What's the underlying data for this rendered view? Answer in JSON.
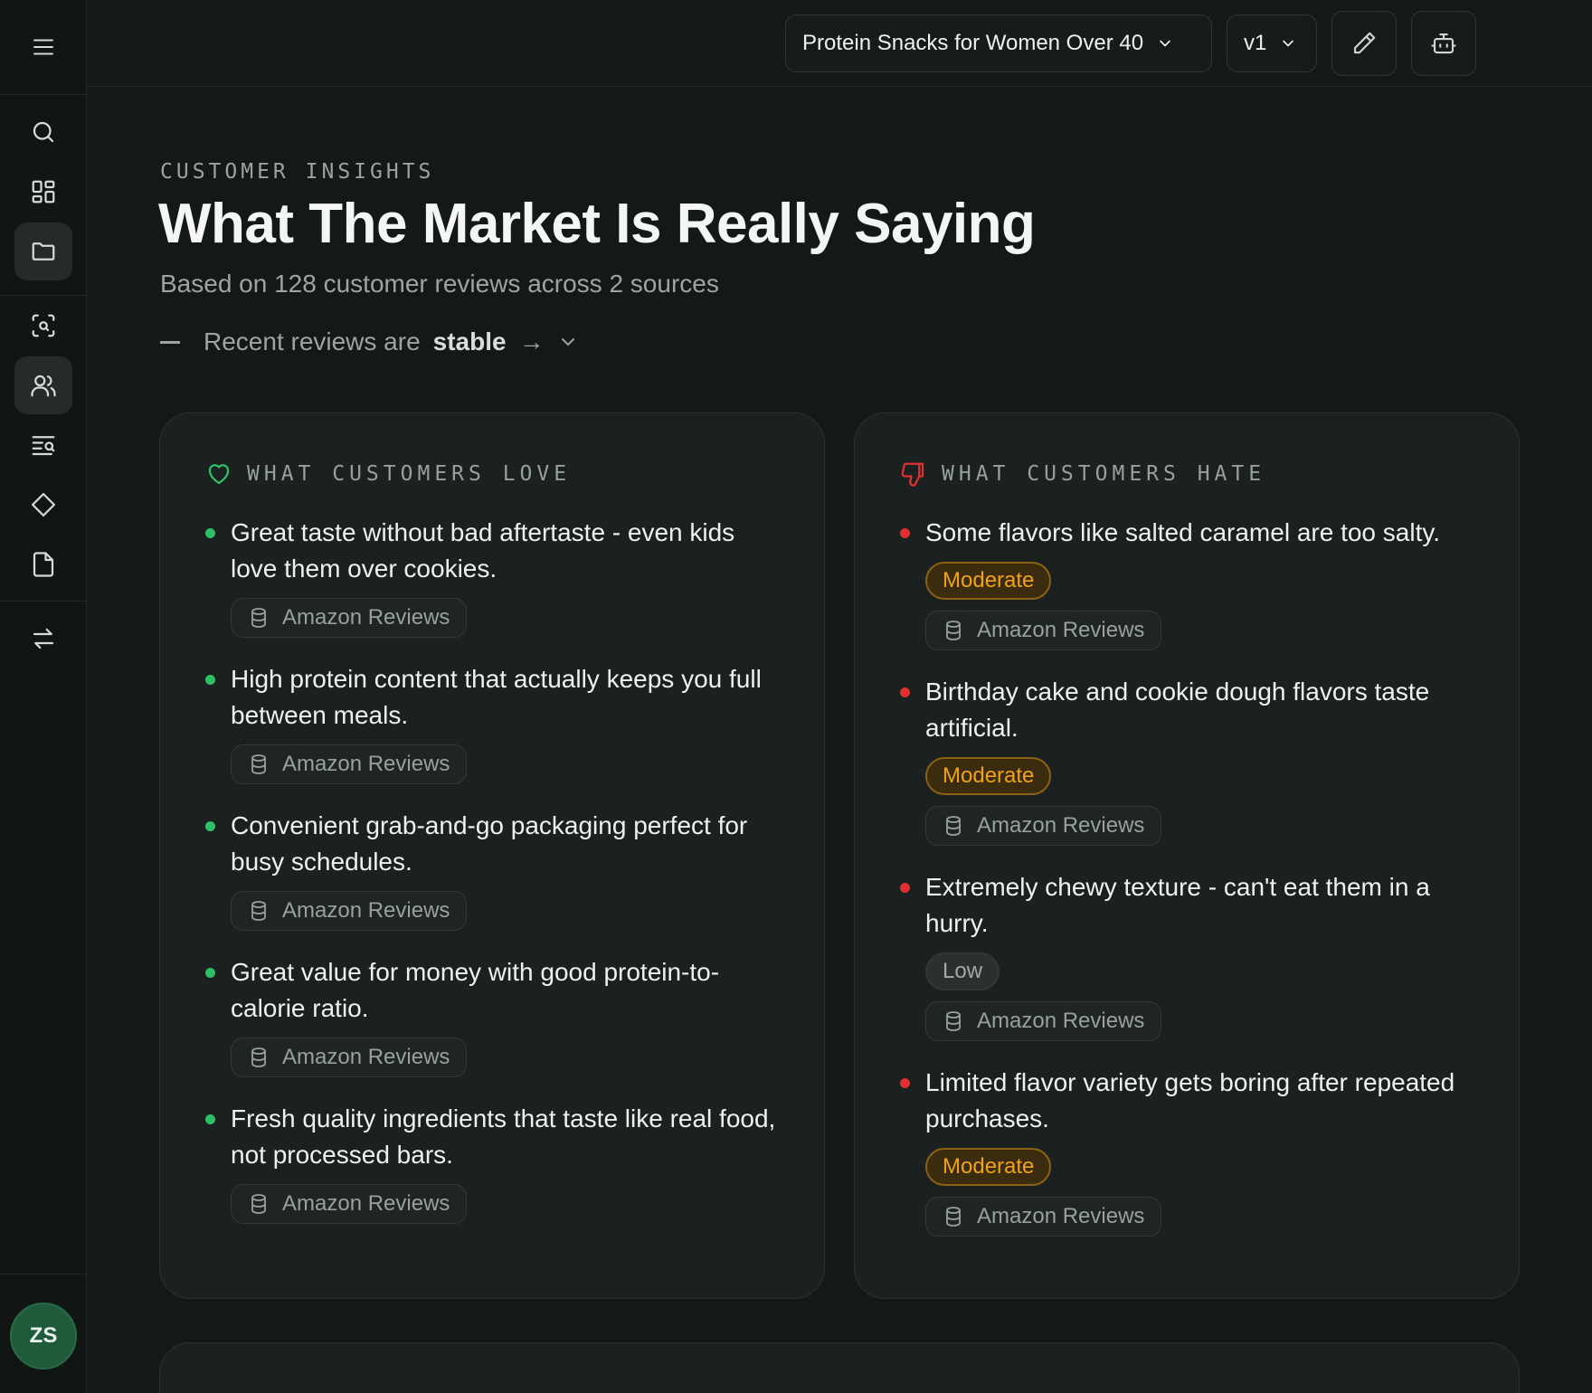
{
  "topbar": {
    "project_select": "Protein Snacks for Women Over 40",
    "version_select": "v1"
  },
  "sidebar": {
    "items": [
      {
        "name": "menu-icon"
      },
      {
        "name": "search-icon"
      },
      {
        "name": "dashboard-icon"
      },
      {
        "name": "folder-icon",
        "active": true
      },
      {
        "name": "scan-search-icon"
      },
      {
        "name": "users-icon",
        "active": true
      },
      {
        "name": "text-search-icon"
      },
      {
        "name": "diamond-icon"
      },
      {
        "name": "file-icon"
      },
      {
        "name": "swap-icon"
      }
    ],
    "avatar_initials": "ZS"
  },
  "header": {
    "eyebrow": "CUSTOMER INSIGHTS",
    "title": "What The Market Is Really Saying",
    "subtitle": "Based on 128 customer reviews across 2 sources",
    "trend_prefix": "Recent reviews are",
    "trend_value": "stable",
    "trend_arrow": "→"
  },
  "love": {
    "heading": "WHAT CUSTOMERS LOVE",
    "accent": "#2fbf64",
    "items": [
      {
        "text": "Great taste without bad aftertaste - even kids love them over cookies.",
        "source": "Amazon Reviews"
      },
      {
        "text": "High protein content that actually keeps you full between meals.",
        "source": "Amazon Reviews"
      },
      {
        "text": "Convenient grab-and-go packaging perfect for busy schedules.",
        "source": "Amazon Reviews"
      },
      {
        "text": "Great value for money with good protein-to-calorie ratio.",
        "source": "Amazon Reviews"
      },
      {
        "text": "Fresh quality ingredients that taste like real food, not processed bars.",
        "source": "Amazon Reviews"
      }
    ]
  },
  "hate": {
    "heading": "WHAT CUSTOMERS HATE",
    "accent": "#e03131",
    "items": [
      {
        "text": "Some flavors like salted caramel are too salty.",
        "severity": "Moderate",
        "source": "Amazon Reviews"
      },
      {
        "text": "Birthday cake and cookie dough flavors taste artificial.",
        "severity": "Moderate",
        "source": "Amazon Reviews"
      },
      {
        "text": "Extremely chewy texture - can't eat them in a hurry.",
        "severity": "Low",
        "source": "Amazon Reviews"
      },
      {
        "text": "Limited flavor variety gets boring after repeated purchases.",
        "severity": "Moderate",
        "source": "Amazon Reviews"
      }
    ]
  }
}
